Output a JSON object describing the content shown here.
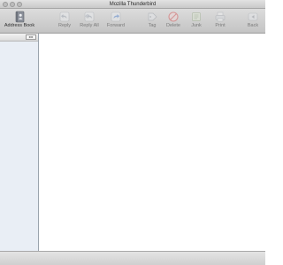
{
  "window": {
    "title": "Mozilla Thunderbird"
  },
  "toolbar": {
    "address_book": "Address Book",
    "reply": "Reply",
    "reply_all": "Reply All",
    "forward": "Forward",
    "tag": "Tag",
    "delete": "Delete",
    "junk": "Junk",
    "print": "Print",
    "back": "Back"
  },
  "sidebar": {
    "toggle_glyph": "◂ ▸"
  },
  "icons": {
    "address_book": "address-book-icon",
    "reply": "reply-icon",
    "reply_all": "reply-all-icon",
    "forward": "forward-icon",
    "tag": "tag-icon",
    "delete": "delete-icon",
    "junk": "junk-icon",
    "print": "print-icon",
    "back": "back-icon"
  },
  "colors": {
    "sidebar_bg": "#e9eef5",
    "toolbar_bg": "#d0d0d0",
    "delete_red": "#d64b4b",
    "forward_blue": "#4a7fd0"
  }
}
